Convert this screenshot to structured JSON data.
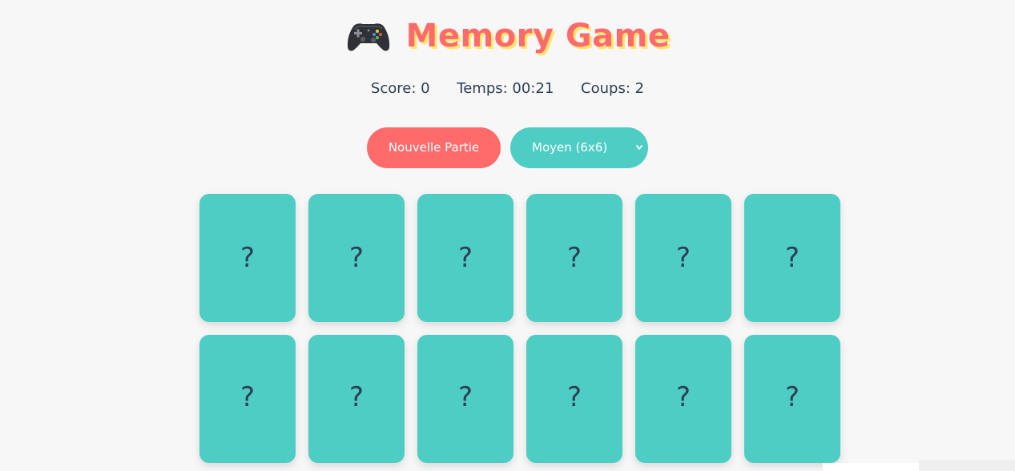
{
  "header": {
    "icon": "gamepad-icon",
    "title": "Memory Game",
    "title_color": "#ff6b6b",
    "title_shadow_color": "#ffe66d"
  },
  "stats": {
    "score": "Score: 0",
    "time": "Temps: 00:21",
    "moves": "Coups: 2"
  },
  "controls": {
    "new_game_label": "Nouvelle Partie",
    "difficulty_selected": "Moyen (6x6)",
    "new_game_color": "#ff6b6b",
    "select_color": "#4ecdc4"
  },
  "board": {
    "card_color": "#4ecdc4",
    "cards": [
      "?",
      "?",
      "?",
      "?",
      "?",
      "?",
      "?",
      "?",
      "?",
      "?",
      "?",
      "?"
    ]
  }
}
